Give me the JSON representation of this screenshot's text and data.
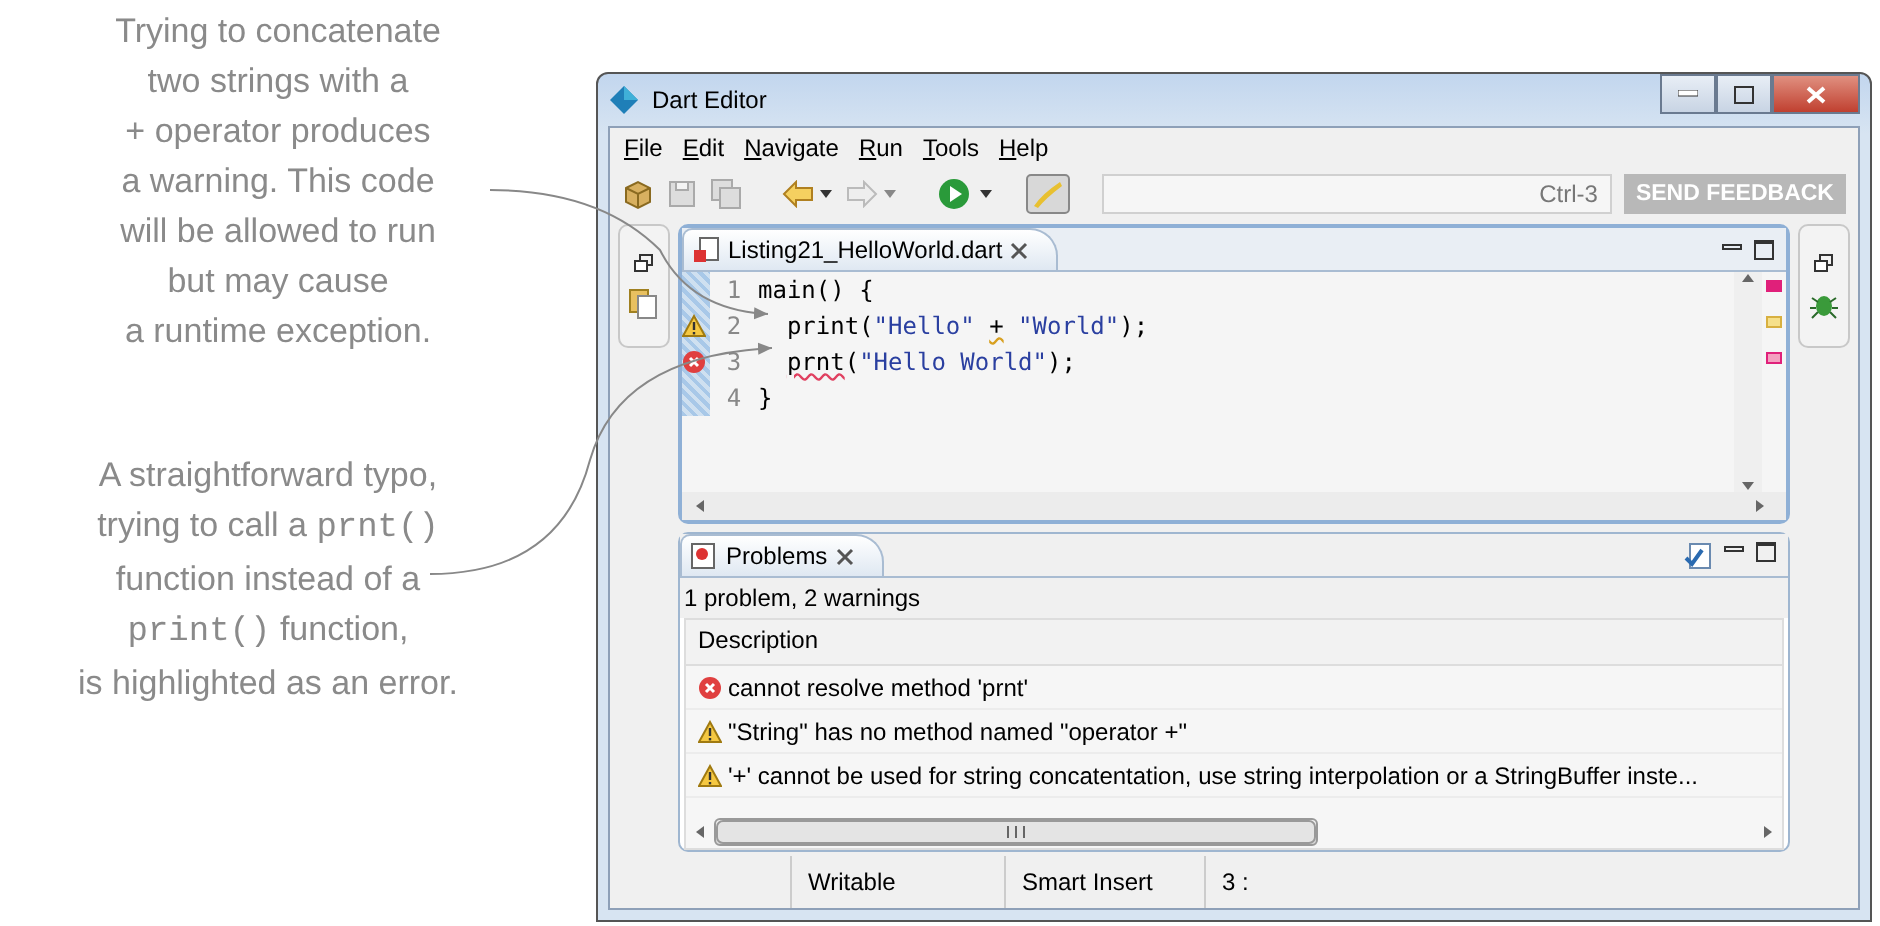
{
  "callouts": [
    {
      "lines": [
        [
          {
            "text": "Trying to concatenate",
            "kind": "text"
          }
        ],
        [
          {
            "text": "two strings with a",
            "kind": "text"
          }
        ],
        [
          {
            "text": "+ operator produces",
            "kind": "text"
          }
        ],
        [
          {
            "text": "a warning. This code",
            "kind": "text"
          }
        ],
        [
          {
            "text": "will be allowed to run",
            "kind": "text"
          }
        ],
        [
          {
            "text": "but may cause",
            "kind": "text"
          }
        ],
        [
          {
            "text": "a runtime exception.",
            "kind": "text"
          }
        ]
      ]
    },
    {
      "lines": [
        [
          {
            "text": "A straightforward typo,",
            "kind": "text"
          }
        ],
        [
          {
            "text": "trying to call a",
            "kind": "text"
          },
          {
            "text": "prnt()",
            "kind": "code"
          }
        ],
        [
          {
            "text": "function instead of a",
            "kind": "text"
          }
        ],
        [
          {
            "text": "print()",
            "kind": "code"
          },
          {
            "text": "function,",
            "kind": "text"
          }
        ],
        [
          {
            "text": "is highlighted as an error.",
            "kind": "text"
          }
        ]
      ]
    }
  ],
  "window": {
    "title": "Dart Editor"
  },
  "menu": [
    "File",
    "Edit",
    "Navigate",
    "Run",
    "Tools",
    "Help"
  ],
  "toolbar": {
    "quick_access": {
      "placeholder": "Ctrl-3"
    },
    "feedback_button": "SEND FEEDBACK"
  },
  "editor": {
    "tab": {
      "label": "Listing21_HelloWorld.dart",
      "selected": true
    },
    "lines": [
      {
        "number": "1",
        "kind": "plain",
        "indented": false,
        "tokens": [
          {
            "text": "main() {",
            "kind": "plain"
          }
        ]
      },
      {
        "number": "2",
        "kind": "warning",
        "indented": true,
        "tokens": [
          {
            "text": "print(",
            "kind": "plain"
          },
          {
            "text": "\"Hello\"",
            "kind": "string"
          },
          {
            "text": "+",
            "kind": "warn"
          },
          {
            "text": "\"World\"",
            "kind": "string"
          },
          {
            "text": ");",
            "kind": "plain"
          }
        ]
      },
      {
        "number": "3",
        "kind": "error",
        "indented": true,
        "tokens": [
          {
            "text": "prnt",
            "kind": "err"
          },
          {
            "text": "(",
            "kind": "plain"
          },
          {
            "text": "\"Hello World\"",
            "kind": "string"
          },
          {
            "text": ");",
            "kind": "plain"
          }
        ]
      },
      {
        "number": "4",
        "kind": "plain",
        "indented": false,
        "tokens": [
          {
            "text": "}",
            "kind": "plain"
          }
        ]
      }
    ]
  },
  "problems": {
    "tab": {
      "label": "Problems",
      "selected": true
    },
    "summary": "1 problem, 2 warnings",
    "column": "Description",
    "rows": [
      {
        "kind": "error",
        "text": "cannot resolve method 'prnt'"
      },
      {
        "kind": "warning",
        "text": "\"String\" has no method named \"operator +\""
      },
      {
        "kind": "warning",
        "text": "'+' cannot be used for string concatentation, use string interpolation or a StringBuffer inste..."
      }
    ]
  },
  "status_bar": [
    "Writable",
    "Smart Insert",
    "3 :"
  ]
}
